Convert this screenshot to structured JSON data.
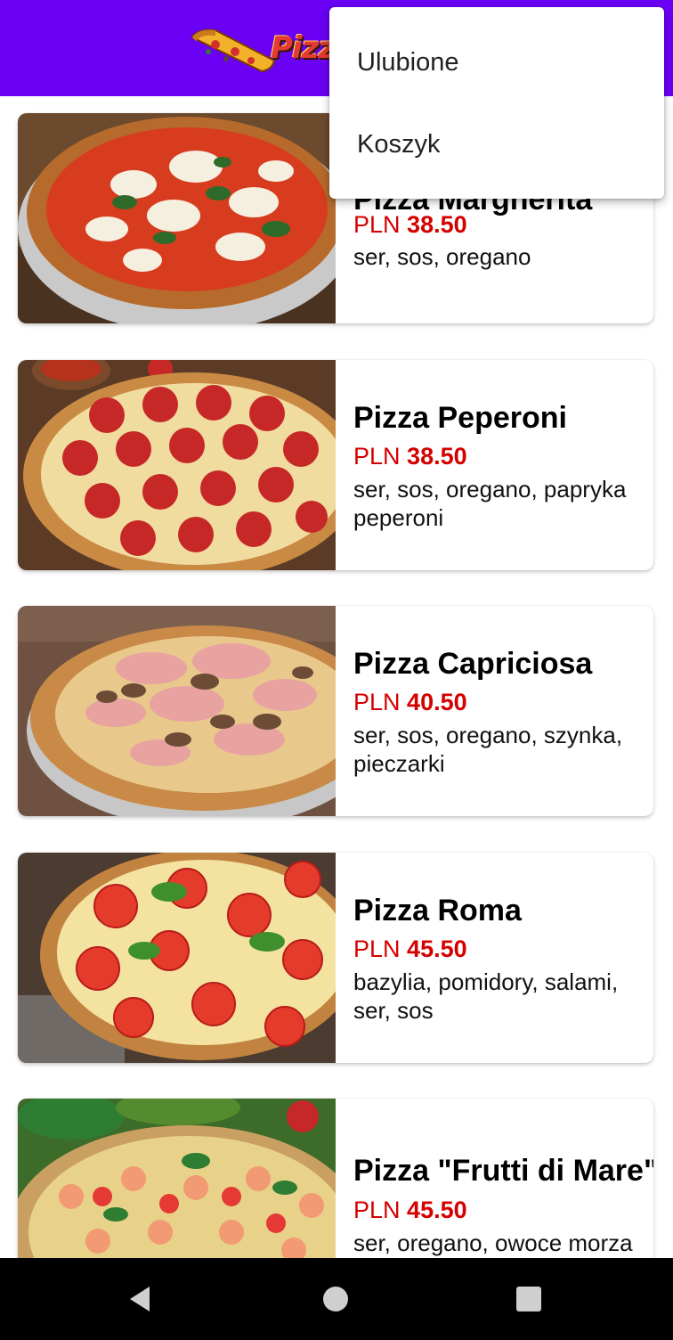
{
  "app": {
    "logo_text": "Pizza"
  },
  "overflow_menu": {
    "items": [
      {
        "label": "Ulubione"
      },
      {
        "label": "Koszyk"
      }
    ]
  },
  "pizzas": [
    {
      "name": "Pizza Margherita",
      "currency": "PLN",
      "price": "38.50",
      "description": "ser, sos, oregano",
      "image": "margherita-photo"
    },
    {
      "name": "Pizza Peperoni",
      "currency": "PLN",
      "price": "38.50",
      "description": "ser, sos, oregano, papryka peperoni",
      "image": "peperoni-photo"
    },
    {
      "name": "Pizza Capriciosa",
      "currency": "PLN",
      "price": "40.50",
      "description": "ser, sos, oregano, szynka, pieczarki",
      "image": "capriciosa-photo"
    },
    {
      "name": "Pizza Roma",
      "currency": "PLN",
      "price": "45.50",
      "description": "bazylia, pomidory, salami, ser, sos",
      "image": "roma-photo"
    },
    {
      "name": "Pizza \"Frutti di Mare\"",
      "currency": "PLN",
      "price": "45.50",
      "description": "ser, oregano, owoce morza",
      "image": "frutti-di-mare-photo"
    }
  ],
  "system_nav": {
    "back": "back-icon",
    "home": "home-icon",
    "recents": "recents-icon"
  },
  "colors": {
    "appbar": "#6a00f4",
    "price": "#d50000",
    "navbar": "#000000"
  }
}
